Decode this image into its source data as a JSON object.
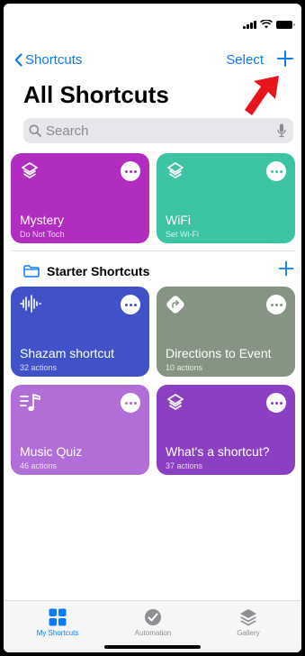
{
  "nav": {
    "back_label": "Shortcuts",
    "select_label": "Select"
  },
  "page_title": "All Shortcuts",
  "search": {
    "placeholder": "Search"
  },
  "my_shortcuts": [
    {
      "name": "Mystery",
      "subtitle": "Do Not Toch",
      "color": "#b02dbf",
      "icon": "layers-icon"
    },
    {
      "name": "WiFi",
      "subtitle": "Set Wi-Fi",
      "color": "#3cc3a4",
      "icon": "layers-icon"
    }
  ],
  "starter_section": {
    "title": "Starter Shortcuts",
    "items": [
      {
        "name": "Shazam shortcut",
        "subtitle": "32 actions",
        "color": "#4152c8",
        "icon": "waveform-icon"
      },
      {
        "name": "Directions to Event",
        "subtitle": "10 actions",
        "color": "#869483",
        "icon": "directions-icon"
      },
      {
        "name": "Music Quiz",
        "subtitle": "46 actions",
        "color": "#b06ed6",
        "icon": "music-list-icon"
      },
      {
        "name": "What's a shortcut?",
        "subtitle": "37 actions",
        "color": "#8b3fc2",
        "icon": "layers-icon"
      }
    ]
  },
  "tabs": [
    {
      "label": "My Shortcuts",
      "active": true,
      "icon": "grid-icon"
    },
    {
      "label": "Automation",
      "active": false,
      "icon": "automation-icon"
    },
    {
      "label": "Gallery",
      "active": false,
      "icon": "gallery-icon"
    }
  ],
  "colors": {
    "accent": "#0a7aff",
    "annotation_arrow": "#e8141c"
  }
}
